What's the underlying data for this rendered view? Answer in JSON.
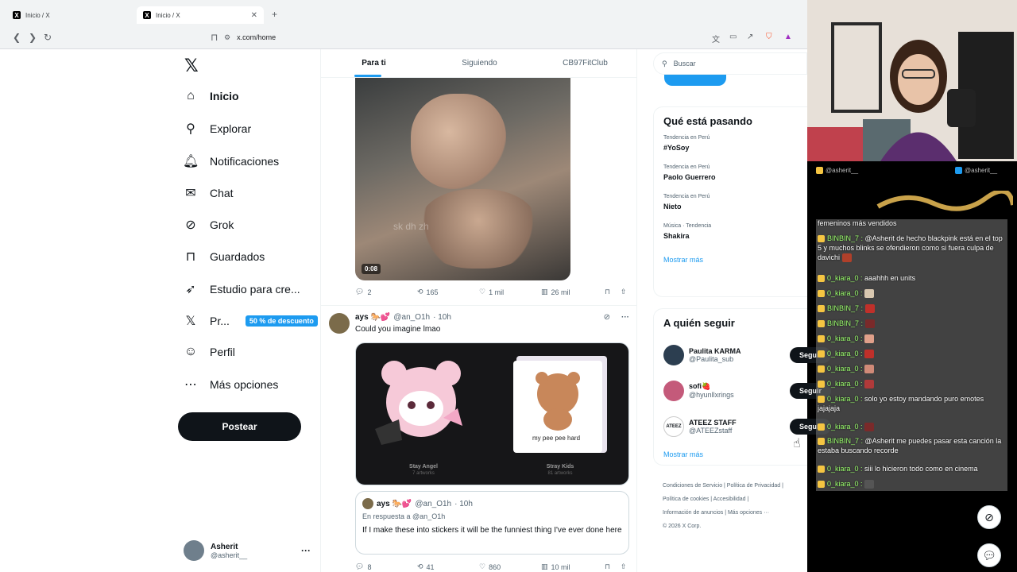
{
  "browser": {
    "tabs": [
      {
        "title": "Inicio / X",
        "active": false
      },
      {
        "title": "Inicio / X",
        "active": true
      }
    ],
    "url": "x.com/home"
  },
  "sidebar": {
    "items": [
      {
        "label": "Inicio",
        "icon": "home-icon",
        "glyph": "⌂"
      },
      {
        "label": "Explorar",
        "icon": "search-icon",
        "glyph": "⚲"
      },
      {
        "label": "Notificaciones",
        "icon": "bell-icon",
        "glyph": "♫"
      },
      {
        "label": "Chat",
        "icon": "mail-icon",
        "glyph": "✉"
      },
      {
        "label": "Grok",
        "icon": "grok-icon",
        "glyph": "⊘"
      },
      {
        "label": "Guardados",
        "icon": "bookmark-icon",
        "glyph": "⊓"
      },
      {
        "label": "Estudio para cre...",
        "icon": "rocket-icon",
        "glyph": "➶"
      },
      {
        "label": "Pr...",
        "icon": "x-logo-icon",
        "glyph": "𝕏"
      },
      {
        "label": "Perfil",
        "icon": "person-icon",
        "glyph": "☺"
      },
      {
        "label": "Más opciones",
        "icon": "more-circle-icon",
        "glyph": "⋯"
      }
    ],
    "discount": "50 % de descuento",
    "post_button": "Postear",
    "me": {
      "name": "Asherit",
      "handle": "@asherit__",
      "more": "···"
    }
  },
  "timeline": {
    "tabs": [
      "Para ti",
      "Siguiendo",
      "CB97FitClub"
    ],
    "post1": {
      "video_time": "0:08",
      "watermark": "sk dh zh",
      "replies": "2",
      "reposts": "165",
      "likes": "1 mil",
      "views": "26 mil"
    },
    "post2": {
      "name": "ays 🐎💕",
      "handle": "@an_O1h",
      "time": "· 10h",
      "text": "Could you imagine lmao",
      "card": {
        "left_title": "Stay Angel",
        "left_sub": "7 artworks",
        "right_title": "Stray Kids",
        "right_sub": "81 artworks",
        "right_caption": "my pee pee hard"
      },
      "quote": {
        "name": "ays 🐎💕",
        "handle": "@an_O1h",
        "time": "· 10h",
        "reply_to": "En respuesta a @an_O1h",
        "text": "If I make these into stickers it will be the funniest thing I've ever done here"
      },
      "replies": "8",
      "reposts": "41",
      "likes": "860",
      "views": "10 mil"
    }
  },
  "right": {
    "search_placeholder": "Buscar",
    "trends_title": "Qué está pasando",
    "trends": [
      {
        "meta": "Tendencia en Perú",
        "name": "#YoSoy"
      },
      {
        "meta": "Tendencia en Perú",
        "name": "Paolo Guerrero"
      },
      {
        "meta": "Tendencia en Perú",
        "name": "Nieto"
      },
      {
        "meta": "Música · Tendencia",
        "name": "Shakira"
      }
    ],
    "show_more": "Mostrar más",
    "follow_title": "A quién seguir",
    "follows": [
      {
        "name": "Paulita KARMA",
        "handle": "@Paulita_sub",
        "button": "Seguir"
      },
      {
        "name": "sofi🍓",
        "handle": "@hyunllxrings",
        "button": "Seguir"
      },
      {
        "name": "ATEEZ STAFF",
        "handle": "@ATEEZstaff",
        "button": "Seguir"
      }
    ],
    "footer": [
      "Condiciones de Servicio | Política de Privacidad |",
      "Política de cookies | Accesibilidad |",
      "Información de anuncios | Más opciones ···",
      "© 2026 X Corp."
    ]
  },
  "stream": {
    "overlay_left": "@asherit__",
    "overlay_right": "@asherit__",
    "chat": [
      {
        "user": "",
        "text": "femeninos más vendidos"
      },
      {
        "user": "BINBIN_7 :",
        "text": "@Asherit de hecho blackpink está en el top 5 y muchos blinks se ofendieron como si fuera culpa de davichi"
      },
      {
        "user": "0_kiara_0 :",
        "text": "aaahhh en units"
      },
      {
        "user": "0_kiara_0 :",
        "text": ""
      },
      {
        "user": "BINBIN_7 :",
        "text": ""
      },
      {
        "user": "BINBIN_7 :",
        "text": ""
      },
      {
        "user": "0_kiara_0 :",
        "text": ""
      },
      {
        "user": "0_kiara_0 :",
        "text": ""
      },
      {
        "user": "0_kiara_0 :",
        "text": ""
      },
      {
        "user": "0_kiara_0 :",
        "text": ""
      },
      {
        "user": "0_kiara_0 :",
        "text": "solo yo estoy mandando puro emotes jajajaja"
      },
      {
        "user": "0_kiara_0 :",
        "text": ""
      },
      {
        "user": "BINBIN_7 :",
        "text": "@Asherit me puedes pasar esta canción la estaba buscando recorde"
      },
      {
        "user": "0_kiara_0 :",
        "text": "siii lo hicieron todo como en cinema"
      },
      {
        "user": "0_kiara_0 :",
        "text": ""
      }
    ]
  }
}
